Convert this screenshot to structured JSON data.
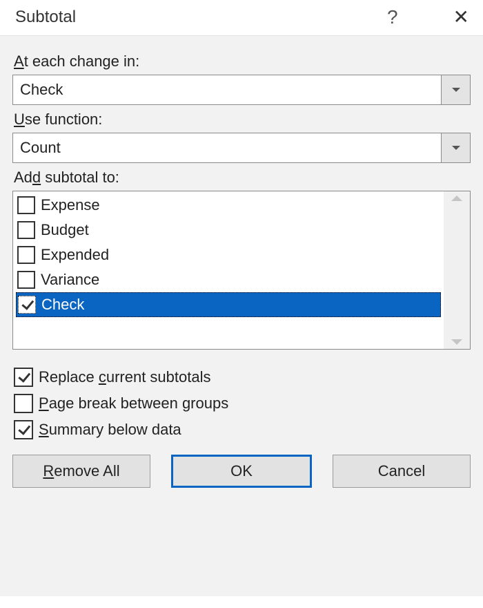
{
  "dialog": {
    "title": "Subtotal",
    "labels": {
      "at_each_change_prefix": "A",
      "at_each_change_suffix": "t each change in:",
      "use_function_prefix": "U",
      "use_function_suffix": "se function:",
      "add_subtotal_prefix": "Ad",
      "add_subtotal_ul": "d",
      "add_subtotal_suffix": " subtotal to:"
    },
    "combo_change": "Check",
    "combo_function": "Count",
    "list": {
      "item0": "Expense",
      "item1": "Budget",
      "item2": "Expended",
      "item3": "Variance",
      "item4": "Check"
    },
    "options": {
      "replace_prefix": "Replace ",
      "replace_ul": "c",
      "replace_suffix": "urrent subtotals",
      "page_prefix": "",
      "page_ul": "P",
      "page_suffix": "age break between groups",
      "summary_prefix": "",
      "summary_ul": "S",
      "summary_suffix": "ummary below data"
    },
    "buttons": {
      "remove_prefix": "",
      "remove_ul": "R",
      "remove_suffix": "emove All",
      "ok": "OK",
      "cancel": "Cancel"
    }
  }
}
